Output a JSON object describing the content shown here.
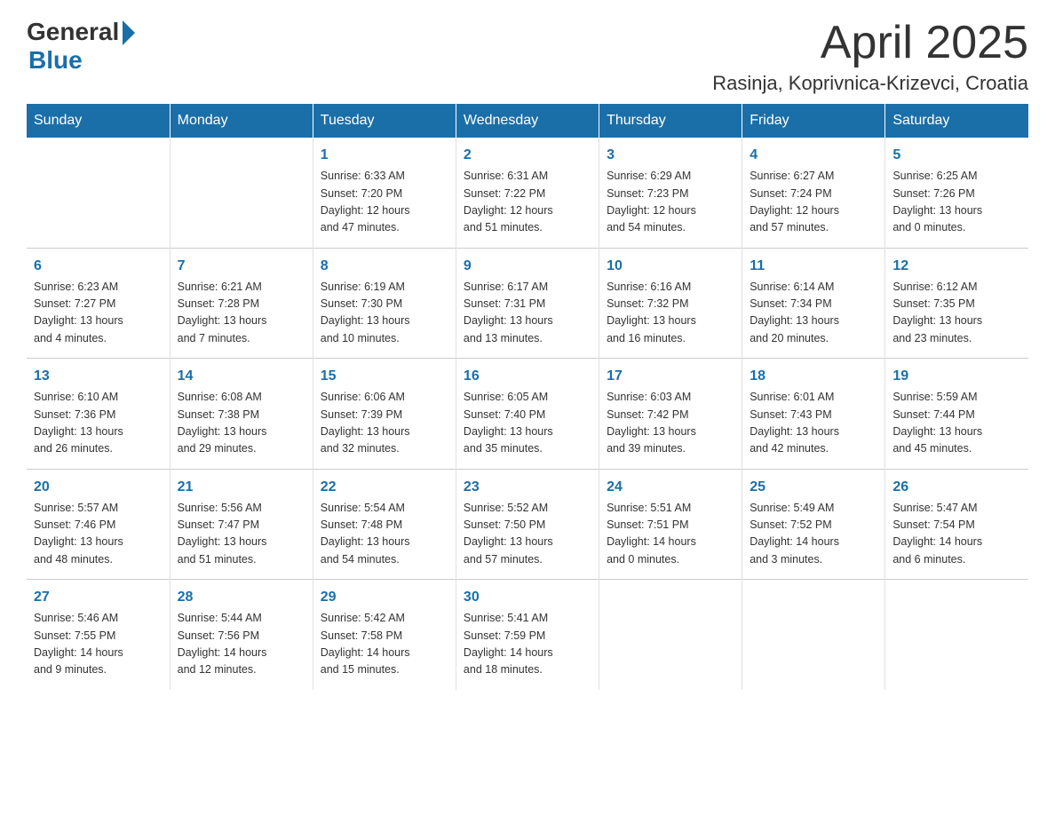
{
  "logo": {
    "general": "General",
    "blue": "Blue"
  },
  "title": "April 2025",
  "location": "Rasinja, Koprivnica-Krizevci, Croatia",
  "weekdays": [
    "Sunday",
    "Monday",
    "Tuesday",
    "Wednesday",
    "Thursday",
    "Friday",
    "Saturday"
  ],
  "weeks": [
    [
      {
        "day": "",
        "info": ""
      },
      {
        "day": "",
        "info": ""
      },
      {
        "day": "1",
        "info": "Sunrise: 6:33 AM\nSunset: 7:20 PM\nDaylight: 12 hours\nand 47 minutes."
      },
      {
        "day": "2",
        "info": "Sunrise: 6:31 AM\nSunset: 7:22 PM\nDaylight: 12 hours\nand 51 minutes."
      },
      {
        "day": "3",
        "info": "Sunrise: 6:29 AM\nSunset: 7:23 PM\nDaylight: 12 hours\nand 54 minutes."
      },
      {
        "day": "4",
        "info": "Sunrise: 6:27 AM\nSunset: 7:24 PM\nDaylight: 12 hours\nand 57 minutes."
      },
      {
        "day": "5",
        "info": "Sunrise: 6:25 AM\nSunset: 7:26 PM\nDaylight: 13 hours\nand 0 minutes."
      }
    ],
    [
      {
        "day": "6",
        "info": "Sunrise: 6:23 AM\nSunset: 7:27 PM\nDaylight: 13 hours\nand 4 minutes."
      },
      {
        "day": "7",
        "info": "Sunrise: 6:21 AM\nSunset: 7:28 PM\nDaylight: 13 hours\nand 7 minutes."
      },
      {
        "day": "8",
        "info": "Sunrise: 6:19 AM\nSunset: 7:30 PM\nDaylight: 13 hours\nand 10 minutes."
      },
      {
        "day": "9",
        "info": "Sunrise: 6:17 AM\nSunset: 7:31 PM\nDaylight: 13 hours\nand 13 minutes."
      },
      {
        "day": "10",
        "info": "Sunrise: 6:16 AM\nSunset: 7:32 PM\nDaylight: 13 hours\nand 16 minutes."
      },
      {
        "day": "11",
        "info": "Sunrise: 6:14 AM\nSunset: 7:34 PM\nDaylight: 13 hours\nand 20 minutes."
      },
      {
        "day": "12",
        "info": "Sunrise: 6:12 AM\nSunset: 7:35 PM\nDaylight: 13 hours\nand 23 minutes."
      }
    ],
    [
      {
        "day": "13",
        "info": "Sunrise: 6:10 AM\nSunset: 7:36 PM\nDaylight: 13 hours\nand 26 minutes."
      },
      {
        "day": "14",
        "info": "Sunrise: 6:08 AM\nSunset: 7:38 PM\nDaylight: 13 hours\nand 29 minutes."
      },
      {
        "day": "15",
        "info": "Sunrise: 6:06 AM\nSunset: 7:39 PM\nDaylight: 13 hours\nand 32 minutes."
      },
      {
        "day": "16",
        "info": "Sunrise: 6:05 AM\nSunset: 7:40 PM\nDaylight: 13 hours\nand 35 minutes."
      },
      {
        "day": "17",
        "info": "Sunrise: 6:03 AM\nSunset: 7:42 PM\nDaylight: 13 hours\nand 39 minutes."
      },
      {
        "day": "18",
        "info": "Sunrise: 6:01 AM\nSunset: 7:43 PM\nDaylight: 13 hours\nand 42 minutes."
      },
      {
        "day": "19",
        "info": "Sunrise: 5:59 AM\nSunset: 7:44 PM\nDaylight: 13 hours\nand 45 minutes."
      }
    ],
    [
      {
        "day": "20",
        "info": "Sunrise: 5:57 AM\nSunset: 7:46 PM\nDaylight: 13 hours\nand 48 minutes."
      },
      {
        "day": "21",
        "info": "Sunrise: 5:56 AM\nSunset: 7:47 PM\nDaylight: 13 hours\nand 51 minutes."
      },
      {
        "day": "22",
        "info": "Sunrise: 5:54 AM\nSunset: 7:48 PM\nDaylight: 13 hours\nand 54 minutes."
      },
      {
        "day": "23",
        "info": "Sunrise: 5:52 AM\nSunset: 7:50 PM\nDaylight: 13 hours\nand 57 minutes."
      },
      {
        "day": "24",
        "info": "Sunrise: 5:51 AM\nSunset: 7:51 PM\nDaylight: 14 hours\nand 0 minutes."
      },
      {
        "day": "25",
        "info": "Sunrise: 5:49 AM\nSunset: 7:52 PM\nDaylight: 14 hours\nand 3 minutes."
      },
      {
        "day": "26",
        "info": "Sunrise: 5:47 AM\nSunset: 7:54 PM\nDaylight: 14 hours\nand 6 minutes."
      }
    ],
    [
      {
        "day": "27",
        "info": "Sunrise: 5:46 AM\nSunset: 7:55 PM\nDaylight: 14 hours\nand 9 minutes."
      },
      {
        "day": "28",
        "info": "Sunrise: 5:44 AM\nSunset: 7:56 PM\nDaylight: 14 hours\nand 12 minutes."
      },
      {
        "day": "29",
        "info": "Sunrise: 5:42 AM\nSunset: 7:58 PM\nDaylight: 14 hours\nand 15 minutes."
      },
      {
        "day": "30",
        "info": "Sunrise: 5:41 AM\nSunset: 7:59 PM\nDaylight: 14 hours\nand 18 minutes."
      },
      {
        "day": "",
        "info": ""
      },
      {
        "day": "",
        "info": ""
      },
      {
        "day": "",
        "info": ""
      }
    ]
  ]
}
